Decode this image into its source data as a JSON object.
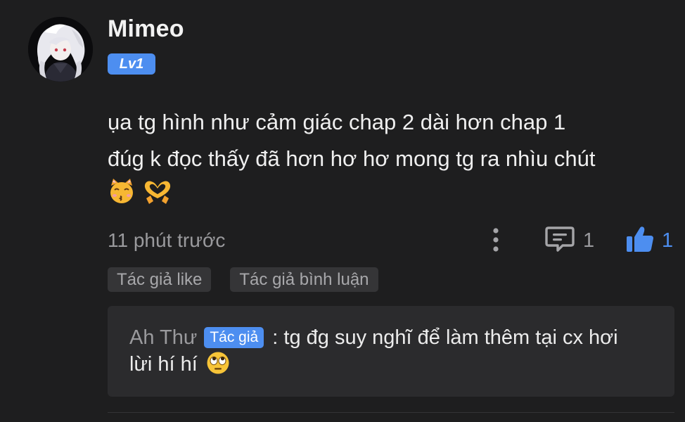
{
  "comment": {
    "username": "Mimeo",
    "level": "Lv1",
    "text_line1": "ụa tg hình như cảm giác chap 2 dài hơn chap 1",
    "text_line2": "đúg k đọc thấy đã hơn hơ hơ mong tg ra nhìu chút",
    "emojis": [
      "kissing-cat-emoji",
      "heart-hands-emoji"
    ],
    "timestamp": "11 phút trước",
    "reply_count": "1",
    "like_count": "1",
    "icons": {
      "more": "more-vertical-icon",
      "reply": "comment-icon",
      "like": "thumbs-up-icon"
    }
  },
  "tags": [
    "Tác giả like",
    "Tác giả bình luận"
  ],
  "reply": {
    "author": "Ah Thư",
    "author_badge": "Tác giả",
    "separator": ":",
    "text_line1": "tg đg suy nghĩ để làm thêm tại cx hơi",
    "text_line2": "lừi hí hí",
    "emoji": "rolling-eyes-emoji"
  },
  "colors": {
    "background": "#1e1e1f",
    "accent": "#4d8ef0",
    "muted_text": "#9a9a9d",
    "tag_background": "#353537",
    "reply_background": "#2b2b2d"
  }
}
